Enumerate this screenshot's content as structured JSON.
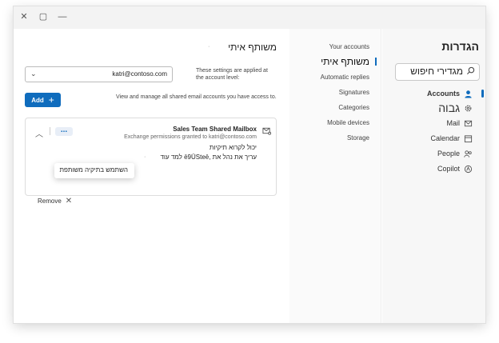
{
  "window": {
    "controls": [
      "✕",
      "▢",
      "—"
    ]
  },
  "nav": {
    "title": "הגדרות",
    "search_value": "מגדירי חיפוש",
    "items": [
      {
        "label": "Accounts",
        "icon": "person-icon"
      },
      {
        "label": "גבוה",
        "icon": "gear-icon"
      },
      {
        "label": "Mail",
        "icon": "mail-icon"
      },
      {
        "label": "Calendar",
        "icon": "calendar-icon"
      },
      {
        "label": "People",
        "icon": "people-icon"
      },
      {
        "label": "Copilot",
        "icon": "copilot-icon"
      }
    ]
  },
  "subnav": {
    "items": [
      {
        "label": "Your accounts"
      },
      {
        "label": "משותף איתי"
      },
      {
        "label": "Automatic replies"
      },
      {
        "label": "Signatures"
      },
      {
        "label": "Categories"
      },
      {
        "label": "Mobile devices"
      },
      {
        "label": "Storage"
      }
    ]
  },
  "main": {
    "title": "משותף איתי",
    "applied_note": "These settings are applied at the account level:",
    "account_value": "katri@contoso.com",
    "manage_note": "View and manage all shared email accounts you have access to.",
    "add_label": "Add",
    "card": {
      "title": "Sales Team Shared Mailbox",
      "subtitle": "Exchange permissions granted to katri@contoso.com",
      "perm1": "יכול לקרוא תיקיות",
      "perm2": "עריך את נהל את ,ē9ÜSteē למד עוד",
      "menu_item": "השתמש בתיקיה משותפת",
      "remove_label": "Remove"
    }
  }
}
